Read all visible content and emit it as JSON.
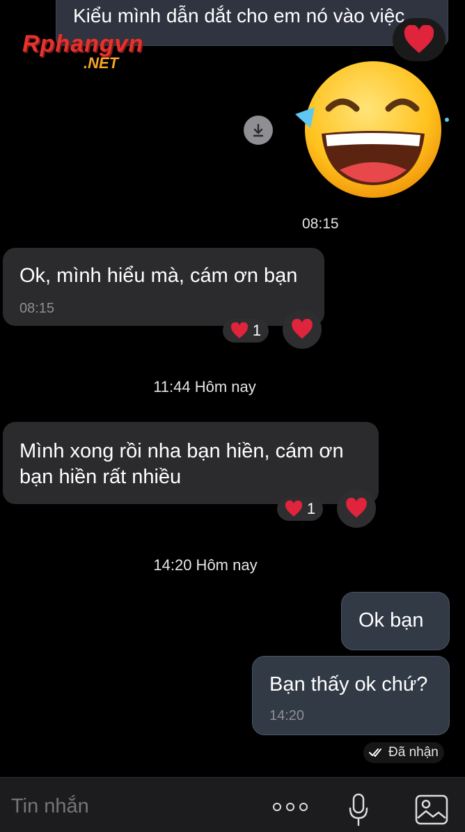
{
  "watermark": {
    "brand": "Rphangvn",
    "tld": ".NET"
  },
  "messages": [
    {
      "type": "quoted",
      "text": "Kiểu mình dẫn dắt cho em nó vào việc"
    },
    {
      "type": "sticker",
      "name": "laughing-emoji-sticker",
      "time": "08:15"
    },
    {
      "type": "received",
      "text": "Ok, mình hiểu mà, cám ơn bạn",
      "time": "08:15",
      "reaction": {
        "emoji": "heart",
        "count": "1"
      }
    },
    {
      "type": "divider",
      "text": "11:44 Hôm nay"
    },
    {
      "type": "received",
      "text": "Mình xong rồi nha bạn hiền, cám ơn bạn hiền rất nhiều",
      "reaction": {
        "emoji": "heart",
        "count": "1"
      }
    },
    {
      "type": "divider",
      "text": "14:20 Hôm nay"
    },
    {
      "type": "sent",
      "text": "Ok bạn"
    },
    {
      "type": "sent",
      "text": "Bạn thấy ok chứ?",
      "time": "14:20"
    }
  ],
  "status": {
    "text": "Đã nhận",
    "icon": "double-check-icon"
  },
  "composer": {
    "placeholder": "Tin nhắn",
    "icons": [
      "more-options-icon",
      "microphone-icon",
      "gallery-icon"
    ]
  },
  "colors": {
    "background": "#000000",
    "bubble_received": "#2b2b2e",
    "bubble_sent": "#323a46",
    "heart": "#e0243b"
  }
}
